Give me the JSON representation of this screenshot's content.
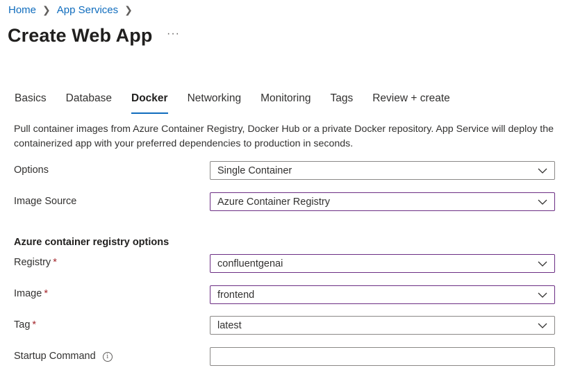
{
  "breadcrumb": {
    "items": [
      "Home",
      "App Services"
    ]
  },
  "header": {
    "title": "Create Web App",
    "more": "···"
  },
  "tabs": [
    "Basics",
    "Database",
    "Docker",
    "Networking",
    "Monitoring",
    "Tags",
    "Review + create"
  ],
  "active_tab": "Docker",
  "description": "Pull container images from Azure Container Registry, Docker Hub or a private Docker repository. App Service will deploy the containerized app with your preferred dependencies to production in seconds.",
  "fields": {
    "options": {
      "label": "Options",
      "value": "Single Container"
    },
    "image_source": {
      "label": "Image Source",
      "value": "Azure Container Registry"
    },
    "section_title": "Azure container registry options",
    "registry": {
      "label": "Registry",
      "required": "*",
      "value": "confluentgenai"
    },
    "image": {
      "label": "Image",
      "required": "*",
      "value": "frontend"
    },
    "tag": {
      "label": "Tag",
      "required": "*",
      "value": "latest"
    },
    "startup_command": {
      "label": "Startup Command",
      "value": ""
    }
  },
  "colors": {
    "link": "#0f6cbd",
    "focus_border": "#6b2d83",
    "required": "#a4262c"
  },
  "icons": {
    "chevron": "chevron-down-icon",
    "info": "info-icon"
  }
}
